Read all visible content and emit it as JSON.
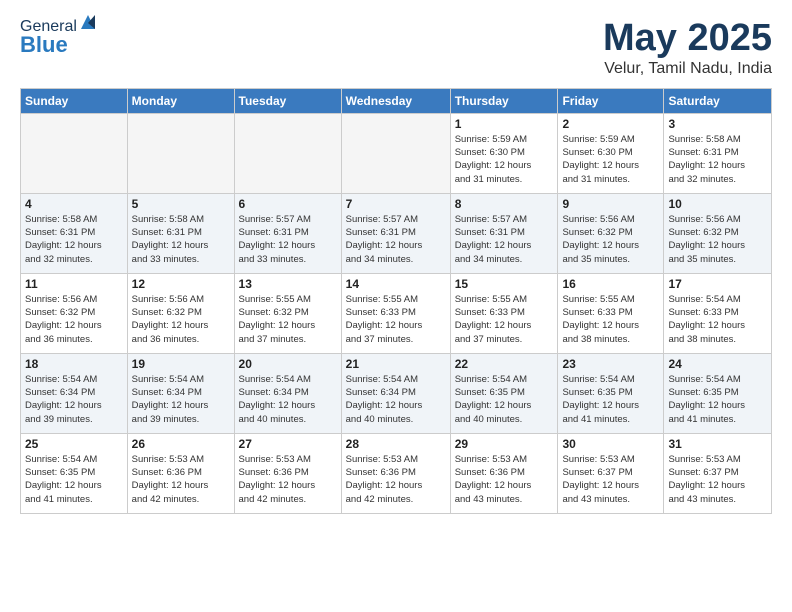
{
  "header": {
    "logo_general": "General",
    "logo_blue": "Blue",
    "month_title": "May 2025",
    "subtitle": "Velur, Tamil Nadu, India"
  },
  "weekdays": [
    "Sunday",
    "Monday",
    "Tuesday",
    "Wednesday",
    "Thursday",
    "Friday",
    "Saturday"
  ],
  "weeks": [
    [
      {
        "day": "",
        "info": ""
      },
      {
        "day": "",
        "info": ""
      },
      {
        "day": "",
        "info": ""
      },
      {
        "day": "",
        "info": ""
      },
      {
        "day": "1",
        "info": "Sunrise: 5:59 AM\nSunset: 6:30 PM\nDaylight: 12 hours\nand 31 minutes."
      },
      {
        "day": "2",
        "info": "Sunrise: 5:59 AM\nSunset: 6:30 PM\nDaylight: 12 hours\nand 31 minutes."
      },
      {
        "day": "3",
        "info": "Sunrise: 5:58 AM\nSunset: 6:31 PM\nDaylight: 12 hours\nand 32 minutes."
      }
    ],
    [
      {
        "day": "4",
        "info": "Sunrise: 5:58 AM\nSunset: 6:31 PM\nDaylight: 12 hours\nand 32 minutes."
      },
      {
        "day": "5",
        "info": "Sunrise: 5:58 AM\nSunset: 6:31 PM\nDaylight: 12 hours\nand 33 minutes."
      },
      {
        "day": "6",
        "info": "Sunrise: 5:57 AM\nSunset: 6:31 PM\nDaylight: 12 hours\nand 33 minutes."
      },
      {
        "day": "7",
        "info": "Sunrise: 5:57 AM\nSunset: 6:31 PM\nDaylight: 12 hours\nand 34 minutes."
      },
      {
        "day": "8",
        "info": "Sunrise: 5:57 AM\nSunset: 6:31 PM\nDaylight: 12 hours\nand 34 minutes."
      },
      {
        "day": "9",
        "info": "Sunrise: 5:56 AM\nSunset: 6:32 PM\nDaylight: 12 hours\nand 35 minutes."
      },
      {
        "day": "10",
        "info": "Sunrise: 5:56 AM\nSunset: 6:32 PM\nDaylight: 12 hours\nand 35 minutes."
      }
    ],
    [
      {
        "day": "11",
        "info": "Sunrise: 5:56 AM\nSunset: 6:32 PM\nDaylight: 12 hours\nand 36 minutes."
      },
      {
        "day": "12",
        "info": "Sunrise: 5:56 AM\nSunset: 6:32 PM\nDaylight: 12 hours\nand 36 minutes."
      },
      {
        "day": "13",
        "info": "Sunrise: 5:55 AM\nSunset: 6:32 PM\nDaylight: 12 hours\nand 37 minutes."
      },
      {
        "day": "14",
        "info": "Sunrise: 5:55 AM\nSunset: 6:33 PM\nDaylight: 12 hours\nand 37 minutes."
      },
      {
        "day": "15",
        "info": "Sunrise: 5:55 AM\nSunset: 6:33 PM\nDaylight: 12 hours\nand 37 minutes."
      },
      {
        "day": "16",
        "info": "Sunrise: 5:55 AM\nSunset: 6:33 PM\nDaylight: 12 hours\nand 38 minutes."
      },
      {
        "day": "17",
        "info": "Sunrise: 5:54 AM\nSunset: 6:33 PM\nDaylight: 12 hours\nand 38 minutes."
      }
    ],
    [
      {
        "day": "18",
        "info": "Sunrise: 5:54 AM\nSunset: 6:34 PM\nDaylight: 12 hours\nand 39 minutes."
      },
      {
        "day": "19",
        "info": "Sunrise: 5:54 AM\nSunset: 6:34 PM\nDaylight: 12 hours\nand 39 minutes."
      },
      {
        "day": "20",
        "info": "Sunrise: 5:54 AM\nSunset: 6:34 PM\nDaylight: 12 hours\nand 40 minutes."
      },
      {
        "day": "21",
        "info": "Sunrise: 5:54 AM\nSunset: 6:34 PM\nDaylight: 12 hours\nand 40 minutes."
      },
      {
        "day": "22",
        "info": "Sunrise: 5:54 AM\nSunset: 6:35 PM\nDaylight: 12 hours\nand 40 minutes."
      },
      {
        "day": "23",
        "info": "Sunrise: 5:54 AM\nSunset: 6:35 PM\nDaylight: 12 hours\nand 41 minutes."
      },
      {
        "day": "24",
        "info": "Sunrise: 5:54 AM\nSunset: 6:35 PM\nDaylight: 12 hours\nand 41 minutes."
      }
    ],
    [
      {
        "day": "25",
        "info": "Sunrise: 5:54 AM\nSunset: 6:35 PM\nDaylight: 12 hours\nand 41 minutes."
      },
      {
        "day": "26",
        "info": "Sunrise: 5:53 AM\nSunset: 6:36 PM\nDaylight: 12 hours\nand 42 minutes."
      },
      {
        "day": "27",
        "info": "Sunrise: 5:53 AM\nSunset: 6:36 PM\nDaylight: 12 hours\nand 42 minutes."
      },
      {
        "day": "28",
        "info": "Sunrise: 5:53 AM\nSunset: 6:36 PM\nDaylight: 12 hours\nand 42 minutes."
      },
      {
        "day": "29",
        "info": "Sunrise: 5:53 AM\nSunset: 6:36 PM\nDaylight: 12 hours\nand 43 minutes."
      },
      {
        "day": "30",
        "info": "Sunrise: 5:53 AM\nSunset: 6:37 PM\nDaylight: 12 hours\nand 43 minutes."
      },
      {
        "day": "31",
        "info": "Sunrise: 5:53 AM\nSunset: 6:37 PM\nDaylight: 12 hours\nand 43 minutes."
      }
    ]
  ]
}
